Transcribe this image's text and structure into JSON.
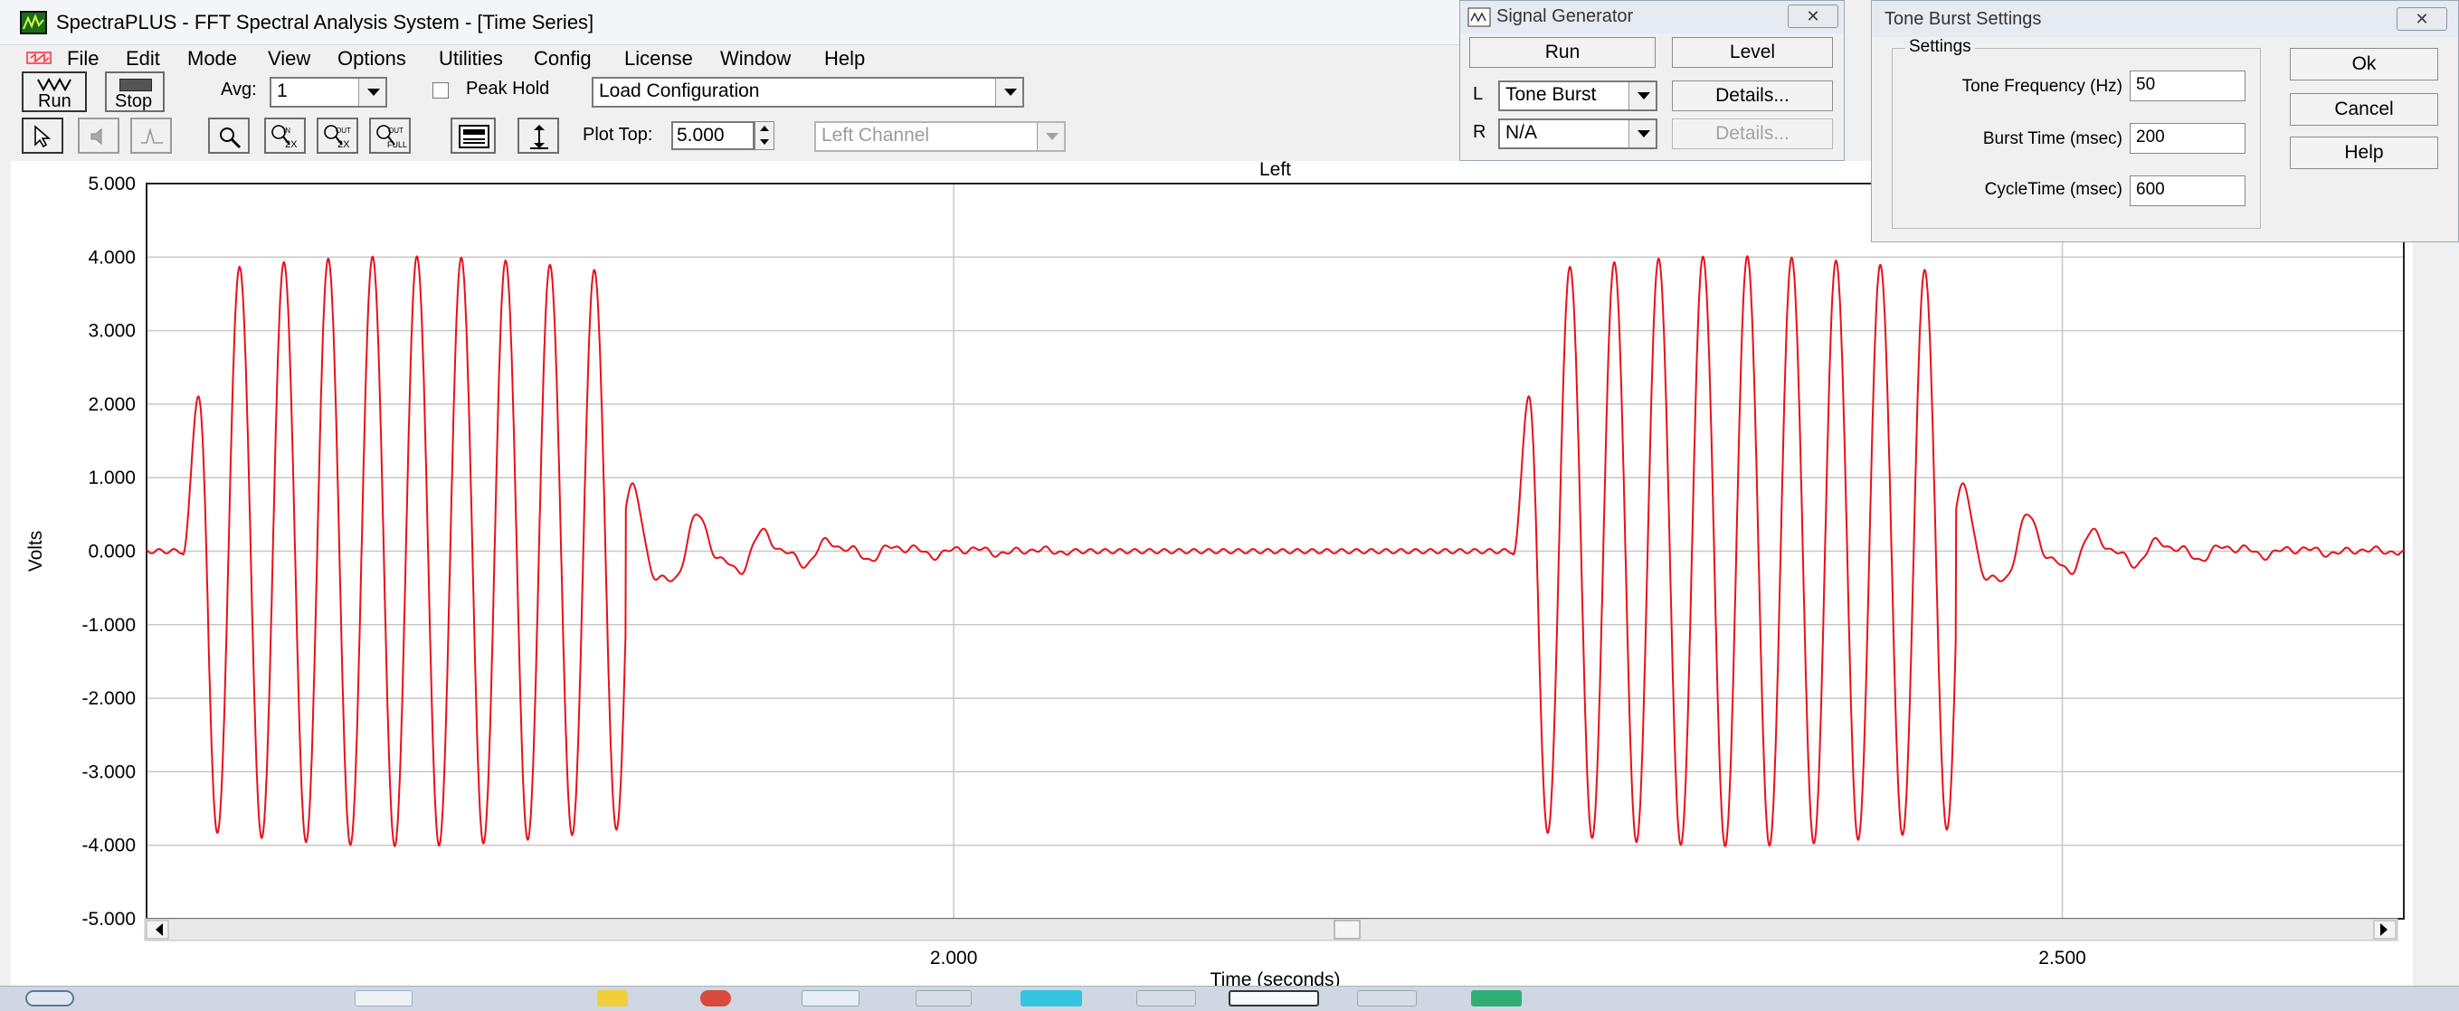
{
  "app": {
    "title": "SpectraPLUS - FFT Spectral Analysis System - [Time Series]"
  },
  "menu": [
    "File",
    "Edit",
    "Mode",
    "View",
    "Options",
    "Utilities",
    "Config",
    "License",
    "Window",
    "Help"
  ],
  "toolbar": {
    "run_label": "Run",
    "stop_label": "Stop",
    "avg_label": "Avg:",
    "avg_value": "1",
    "peak_hold_label": "Peak Hold",
    "config_select": "Load Configuration",
    "zoom_in_label": "IN 2X",
    "zoom_out_label": "OUT 2X",
    "zoom_full_label": "OUT FULL",
    "plot_top_label": "Plot Top:",
    "plot_top_value": "5.000",
    "channel_select": "Left Channel"
  },
  "signal_generator": {
    "title": "Signal Generator",
    "run_label": "Run",
    "level_label": "Level",
    "left_channel_label": "L",
    "left_signal": "Tone Burst",
    "right_channel_label": "R",
    "right_signal": "N/A",
    "details_label": "Details...",
    "details_disabled_label": "Details..."
  },
  "tone_burst_settings": {
    "title": "Tone Burst Settings",
    "group_label": "Settings",
    "fields": [
      {
        "label": "Tone Frequency (Hz)",
        "value": "50"
      },
      {
        "label": "Burst Time (msec)",
        "value": "200"
      },
      {
        "label": "CycleTime (msec)",
        "value": "600"
      }
    ],
    "ok_label": "Ok",
    "cancel_label": "Cancel",
    "help_label": "Help"
  },
  "chart_data": {
    "type": "line",
    "title": "Left",
    "xlabel": "Time (seconds)",
    "ylabel": "Volts",
    "x_ticks": [
      "2.000",
      "2.500"
    ],
    "x_tick_values": [
      2.0,
      2.5
    ],
    "y_ticks": [
      "5.000",
      "4.000",
      "3.000",
      "2.000",
      "1.000",
      "0.000",
      "-1.000",
      "-2.000",
      "-3.000",
      "-4.000",
      "-5.000"
    ],
    "ylim": [
      -5,
      5
    ],
    "xlim": [
      1.636,
      2.654
    ],
    "grid": true,
    "color": "#e8101a",
    "signal": {
      "frequency_hz": 50,
      "burst_ms": 200,
      "cycle_ms": 600,
      "amplitude_v": 4.0,
      "burst_starts": [
        1.652,
        2.252
      ]
    }
  },
  "colors": {
    "trace": "#e8101a",
    "grid": "#c8c8c8",
    "window_bg": "#f0f0f0"
  }
}
